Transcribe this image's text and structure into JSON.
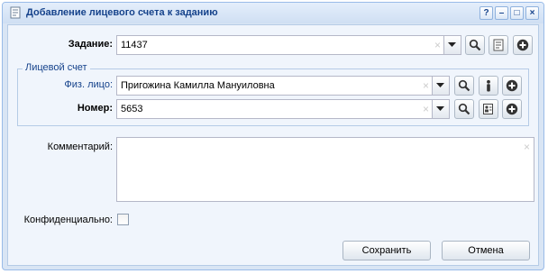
{
  "window": {
    "title": "Добавление лицевого счета к заданию",
    "title_icon": "document-scroll-icon",
    "tools": [
      "help-icon",
      "minimize-icon",
      "maximize-icon",
      "close-icon"
    ]
  },
  "form": {
    "task": {
      "label": "Задание:",
      "value": "11437",
      "clear": "×"
    },
    "fieldset_legend": "Лицевой счет",
    "person": {
      "label": "Физ. лицо:",
      "value": "Пригожина Камилла Мануиловна",
      "clear": "×"
    },
    "number": {
      "label": "Номер:",
      "value": "5653",
      "clear": "×"
    },
    "comment": {
      "label": "Комментарий:",
      "value": "",
      "clear": "×"
    },
    "confidential": {
      "label": "Конфиденциально:",
      "checked": false
    }
  },
  "buttons": {
    "save": "Сохранить",
    "cancel": "Отмена"
  },
  "tool_glyphs": {
    "help": "?",
    "minimize": "–",
    "maximize": "□",
    "close": "×"
  },
  "colors": {
    "title_text": "#15428b",
    "window_border": "#99bbe8",
    "panel_bg": "#f0f5fc"
  }
}
